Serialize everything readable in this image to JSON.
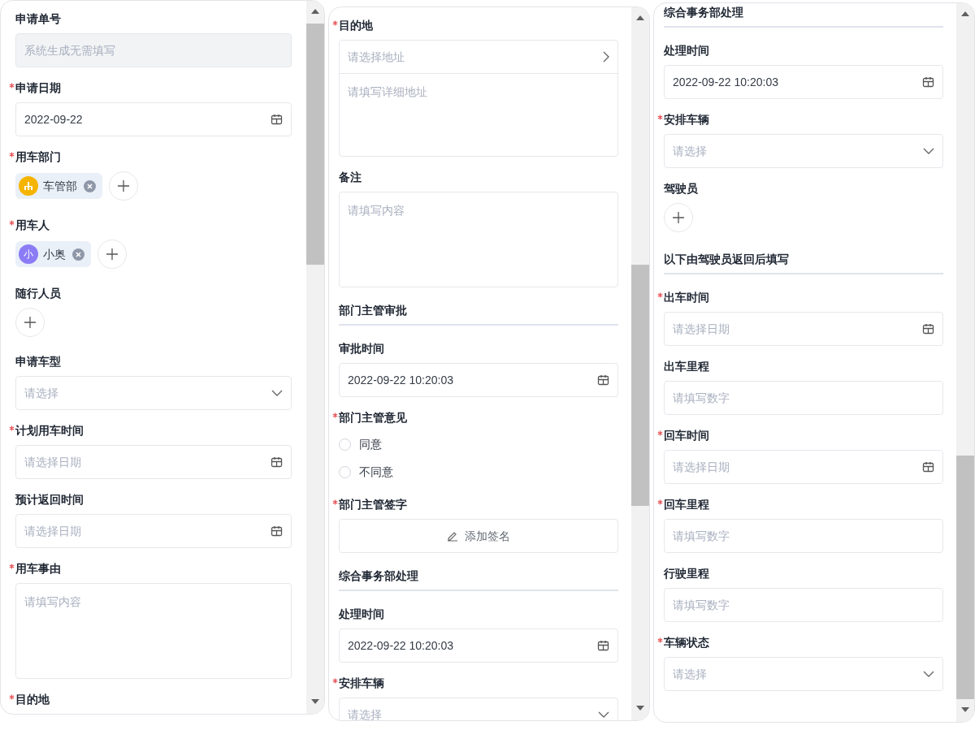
{
  "panels": [
    {
      "fields": [
        {
          "kind": "text",
          "label": "申请单号",
          "required": false,
          "disabled": true,
          "placeholder": "系统生成无需填写"
        },
        {
          "kind": "date",
          "label": "申请日期",
          "required": true,
          "value": "2022-09-22"
        },
        {
          "kind": "chips",
          "label": "用车部门",
          "required": true,
          "chips": [
            {
              "kind": "department",
              "color": "#f5b400",
              "label": "车管部"
            }
          ]
        },
        {
          "kind": "chips",
          "label": "用车人",
          "required": true,
          "chips": [
            {
              "kind": "person",
              "avatar_text": "小",
              "color": "#8b7cf6",
              "label": "小奥"
            }
          ]
        },
        {
          "kind": "chips",
          "label": "随行人员",
          "required": false
        },
        {
          "kind": "select",
          "label": "申请车型",
          "required": false,
          "placeholder": "请选择"
        },
        {
          "kind": "date",
          "label": "计划用车时间",
          "required": true,
          "placeholder": "请选择日期"
        },
        {
          "kind": "date",
          "label": "预计返回时间",
          "required": false,
          "placeholder": "请选择日期"
        },
        {
          "kind": "textarea",
          "label": "用车事由",
          "required": true,
          "placeholder": "请填写内容"
        },
        {
          "kind": "label",
          "label": "目的地",
          "required": true
        }
      ]
    },
    {
      "fields": [
        {
          "kind": "address",
          "label": "目的地",
          "required": true,
          "placeholder": "请选择地址",
          "detail_placeholder": "请填写详细地址"
        },
        {
          "kind": "textarea",
          "label": "备注",
          "required": false,
          "placeholder": "请填写内容"
        },
        {
          "kind": "section",
          "label": "部门主管审批"
        },
        {
          "kind": "date",
          "label": "审批时间",
          "required": false,
          "value": "2022-09-22 10:20:03"
        },
        {
          "kind": "radio",
          "label": "部门主管意见",
          "required": true,
          "options": [
            {
              "label": "同意",
              "selected": false
            },
            {
              "label": "不同意",
              "selected": false
            }
          ]
        },
        {
          "kind": "signature",
          "label": "部门主管签字",
          "required": true,
          "button": "添加签名"
        },
        {
          "kind": "section",
          "label": "综合事务部处理"
        },
        {
          "kind": "date",
          "label": "处理时间",
          "required": false,
          "value": "2022-09-22 10:20:03"
        },
        {
          "kind": "select",
          "label": "安排车辆",
          "required": true,
          "placeholder": "请选择"
        }
      ]
    },
    {
      "fields": [
        {
          "kind": "section",
          "label": "综合事务部处理"
        },
        {
          "kind": "date",
          "label": "处理时间",
          "required": false,
          "value": "2022-09-22 10:20:03"
        },
        {
          "kind": "select",
          "label": "安排车辆",
          "required": true,
          "placeholder": "请选择"
        },
        {
          "kind": "chips",
          "label": "驾驶员",
          "required": false
        },
        {
          "kind": "section",
          "label": "以下由驾驶员返回后填写"
        },
        {
          "kind": "date",
          "label": "出车时间",
          "required": true,
          "placeholder": "请选择日期"
        },
        {
          "kind": "number",
          "label": "出车里程",
          "required": false,
          "placeholder": "请填写数字"
        },
        {
          "kind": "date",
          "label": "回车时间",
          "required": true,
          "placeholder": "请选择日期"
        },
        {
          "kind": "number",
          "label": "回车里程",
          "required": true,
          "placeholder": "请填写数字"
        },
        {
          "kind": "number",
          "label": "行驶里程",
          "required": false,
          "placeholder": "请填写数字"
        },
        {
          "kind": "select",
          "label": "车辆状态",
          "required": true,
          "placeholder": "请选择"
        }
      ]
    }
  ]
}
